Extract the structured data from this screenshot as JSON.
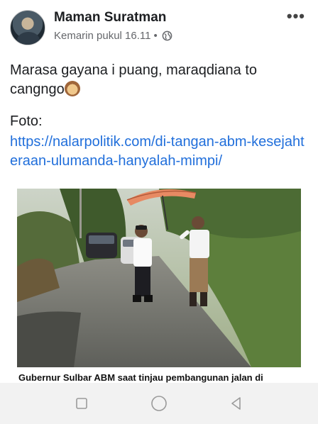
{
  "post": {
    "author": "Maman Suratman",
    "timestamp": "Kemarin pukul 16.11",
    "separator": "•",
    "privacy_icon": "globe-icon",
    "more_label": "•••",
    "text_line1": "Marasa gayana i puang, maraqdiana to",
    "text_line2": "cangngo",
    "emoji": "monkey-face-emoji",
    "foto_label": "Foto:",
    "link": "https://nalarpolitik.com/di-tangan-abm-kesejahteraan-ulumanda-hanyalah-mimpi/"
  },
  "photo": {
    "caption": "Gubernur Sulbar ABM saat tinjau pembangunan jalan di"
  },
  "navbar": {
    "items": [
      "recent-apps-icon",
      "home-icon",
      "back-icon"
    ]
  },
  "colors": {
    "link": "#216fdb",
    "text": "#1c1e21",
    "meta": "#65676b",
    "navbar": "#f2f2f2"
  }
}
